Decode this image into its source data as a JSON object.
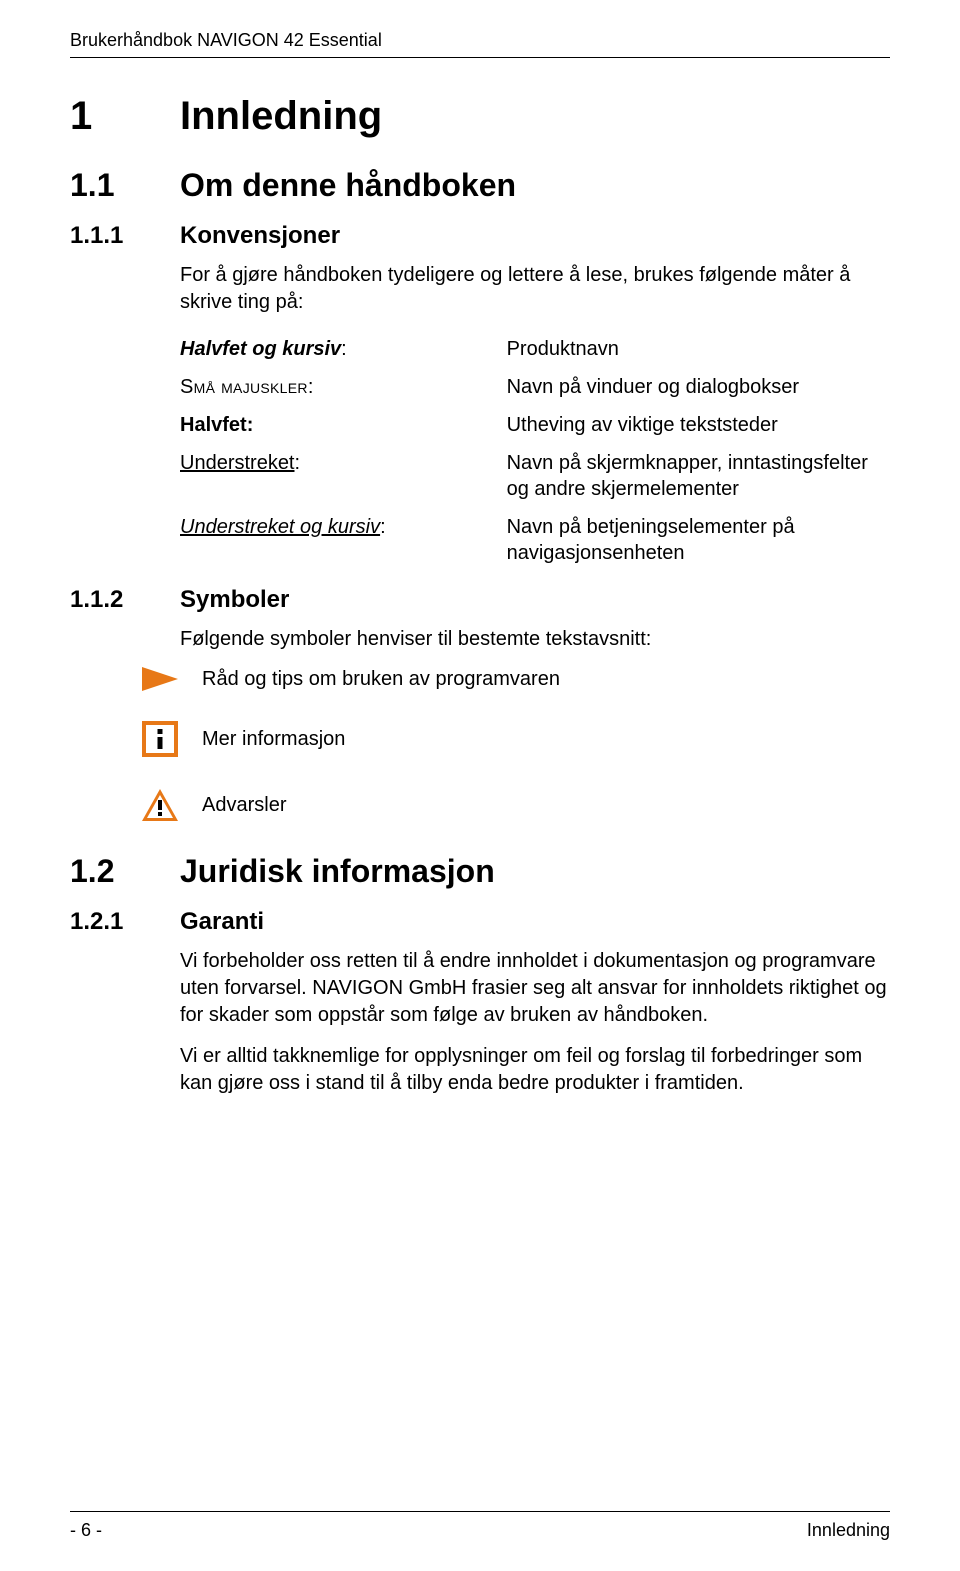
{
  "header": {
    "title": "Brukerhåndbok NAVIGON 42 Essential"
  },
  "h1": {
    "num": "1",
    "title": "Innledning"
  },
  "h2_1": {
    "num": "1.1",
    "title": "Om denne håndboken"
  },
  "h3_1": {
    "num": "1.1.1",
    "title": "Konvensjoner"
  },
  "intro": "For å gjøre håndboken tydeligere og lettere å lese, brukes følgende måter å skrive ting på:",
  "conv": {
    "rows": [
      {
        "left_text": "Halvfet og kursiv",
        "left_suffix": ":",
        "right": "Produktnavn",
        "style": "halvfet-kursiv"
      },
      {
        "left_text": "Små majuskler",
        "left_suffix": ":",
        "right": "Navn på vinduer og dialogbokser",
        "style": "smallcaps"
      },
      {
        "left_text": "Halvfet:",
        "left_suffix": "",
        "right": "Utheving av viktige tekststeder",
        "style": "bold"
      },
      {
        "left_text": "Understreket",
        "left_suffix": ":",
        "right": "Navn på skjermknapper, inntastingsfelter og andre skjermelementer",
        "style": "understreket"
      },
      {
        "left_text": "Understreket og kursiv",
        "left_suffix": ":",
        "right": "Navn på betjeningselementer på navigasjonsenheten",
        "style": "understreket-kursiv"
      }
    ]
  },
  "h3_2": {
    "num": "1.1.2",
    "title": "Symboler"
  },
  "symbolsIntro": "Følgende symboler henviser til bestemte tekstavsnitt:",
  "symbols": {
    "tip": "Råd og tips om bruken av programvaren",
    "info": "Mer informasjon",
    "warn": "Advarsler"
  },
  "h2_2": {
    "num": "1.2",
    "title": "Juridisk informasjon"
  },
  "h3_3": {
    "num": "1.2.1",
    "title": "Garanti"
  },
  "garanti": {
    "p1": "Vi forbeholder oss retten til å endre innholdet i dokumentasjon og programvare uten forvarsel. NAVIGON GmbH frasier seg alt ansvar for innholdets riktighet og for skader som oppstår som følge av bruken av håndboken.",
    "p2": "Vi er alltid takknemlige for opplysninger om feil og forslag til forbedringer som kan gjøre oss i stand til å tilby enda bedre produkter i framtiden."
  },
  "footer": {
    "page": "- 6 -",
    "section": "Innledning"
  },
  "colors": {
    "accent": "#e77817"
  }
}
